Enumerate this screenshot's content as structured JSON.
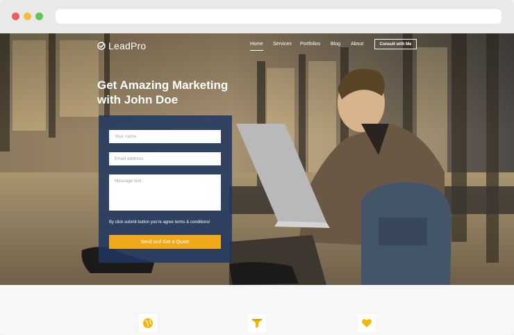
{
  "brand": {
    "name": "LeadPro",
    "logo_icon": "check-circle-icon"
  },
  "nav": {
    "items": [
      {
        "label": "Home",
        "active": true
      },
      {
        "label": "Services",
        "active": false
      },
      {
        "label": "Portfolios",
        "active": false
      },
      {
        "label": "Blog",
        "active": false
      },
      {
        "label": "About",
        "active": false
      }
    ],
    "cta_label": "Consult with Me"
  },
  "hero": {
    "headline_line1": "Get Amazing Marketing",
    "headline_line2": "with John Doe"
  },
  "form": {
    "name_placeholder": "Your name",
    "name_value": "",
    "email_placeholder": "Email address",
    "email_value": "",
    "message_placeholder": "Message text",
    "message_value": "",
    "terms_text": "By click submit button you're agree terms & conditions!",
    "submit_label": "Send and Get a Quote"
  },
  "features": {
    "icons": [
      "globe-icon",
      "funnel-icon",
      "heart-icon"
    ]
  },
  "colors": {
    "accent": "#f0a91a",
    "form_panel": "#1f3661",
    "icon_yellow": "#f4b400"
  }
}
